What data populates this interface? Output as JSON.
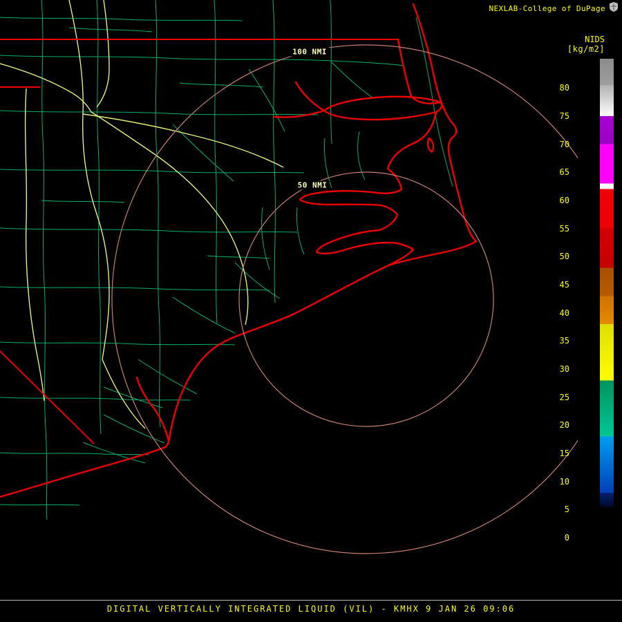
{
  "header": {
    "brand": "NEXLAB-College of DuPage",
    "product_code": "NIDS",
    "units": "[kg/m2]"
  },
  "map": {
    "range_ring_labels": {
      "outer": "100 NMI",
      "inner": "50 NMI"
    }
  },
  "colorbar": {
    "ticks": [
      "80",
      "75",
      "70",
      "65",
      "60",
      "55",
      "50",
      "45",
      "40",
      "35",
      "30",
      "25",
      "20",
      "15",
      "10",
      "5",
      "0"
    ],
    "segments": [
      {
        "from": 85.2,
        "to": 80.5,
        "top": "#8c8c8c",
        "bottom": "#9e9e9e"
      },
      {
        "from": 80.5,
        "to": 75,
        "top": "#b2b2b2",
        "bottom": "#ffffff"
      },
      {
        "from": 75,
        "to": 70,
        "top": "#aa00d4",
        "bottom": "#9900c4"
      },
      {
        "from": 70,
        "to": 63,
        "top": "#ff00ff",
        "bottom": "#ff00ff"
      },
      {
        "from": 63,
        "to": 62,
        "top": "#ffffff",
        "bottom": "#ffffff"
      },
      {
        "from": 62,
        "to": 55,
        "top": "#f00000",
        "bottom": "#ee0000"
      },
      {
        "from": 55,
        "to": 48,
        "top": "#d40000",
        "bottom": "#c60000"
      },
      {
        "from": 48,
        "to": 43,
        "top": "#a85000",
        "bottom": "#b85a00"
      },
      {
        "from": 43,
        "to": 38,
        "top": "#d07200",
        "bottom": "#e68a00"
      },
      {
        "from": 38,
        "to": 28,
        "top": "#dede00",
        "bottom": "#ffff00"
      },
      {
        "from": 28,
        "to": 18,
        "top": "#00935f",
        "bottom": "#00c896"
      },
      {
        "from": 18,
        "to": 8,
        "top": "#009cf0",
        "bottom": "#0040b8"
      },
      {
        "from": 8,
        "to": 5.5,
        "top": "#002070",
        "bottom": "#000a28"
      },
      {
        "from": 5.5,
        "to": -3.3,
        "top": "#000000",
        "bottom": "#000000"
      }
    ]
  },
  "footer": {
    "caption": "DIGITAL VERTICALLY INTEGRATED LIQUID (VIL) - KMHX 9 JAN 26 09:06"
  },
  "colors": {
    "background": "#000000",
    "label_yellow": "#ffff00",
    "ring_label": "#ffffb4",
    "coastline": "#ee0000",
    "county_lines": "#00b06a",
    "highways": "#e6ef7a",
    "range_rings": "#c98070",
    "divider": "#b9b9b9",
    "logo_gray": "#c0c0c0"
  }
}
